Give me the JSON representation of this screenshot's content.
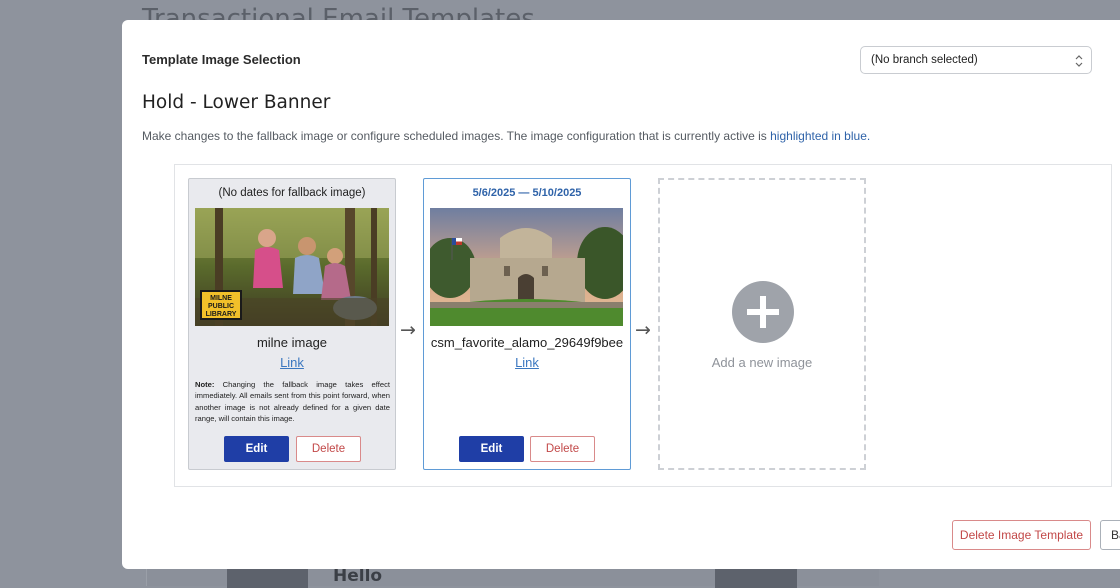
{
  "background": {
    "page_title": "Transactional Email Templates",
    "hello_text": "Hello"
  },
  "modal": {
    "title": "Template Image Selection",
    "branch_select": {
      "value": "(No branch selected)"
    },
    "template_name": "Hold - Lower Banner",
    "description": "Make changes to the fallback image or configure scheduled images. The image configuration that is currently active is ",
    "description_highlight": "highlighted in blue.",
    "fallback_card": {
      "header": "(No dates for fallback image)",
      "image_badge": [
        "MILNE",
        "PUBLIC",
        "LIBRARY"
      ],
      "image_name": "milne image",
      "link_label": "Link",
      "note_label": "Note:",
      "note_text": " Changing the fallback image takes effect immediately. All emails sent from this point forward, when another image is not already defined for a given date range, will contain this image.",
      "edit_label": "Edit",
      "delete_label": "Delete"
    },
    "scheduled_card": {
      "date_range": "5/6/2025 — 5/10/2025",
      "image_name": "csm_favorite_alamo_29649f9bee",
      "link_label": "Link",
      "edit_label": "Edit",
      "delete_label": "Delete"
    },
    "arrow": "→",
    "add_card": {
      "label": "Add a new image"
    },
    "footer": {
      "delete_template_label": "Delete Image Template",
      "back_label": "Back"
    }
  },
  "colors": {
    "primary": "#1f3ea6",
    "danger": "#c24848",
    "active_border": "#5f9bd6",
    "link": "#3c78c0"
  }
}
